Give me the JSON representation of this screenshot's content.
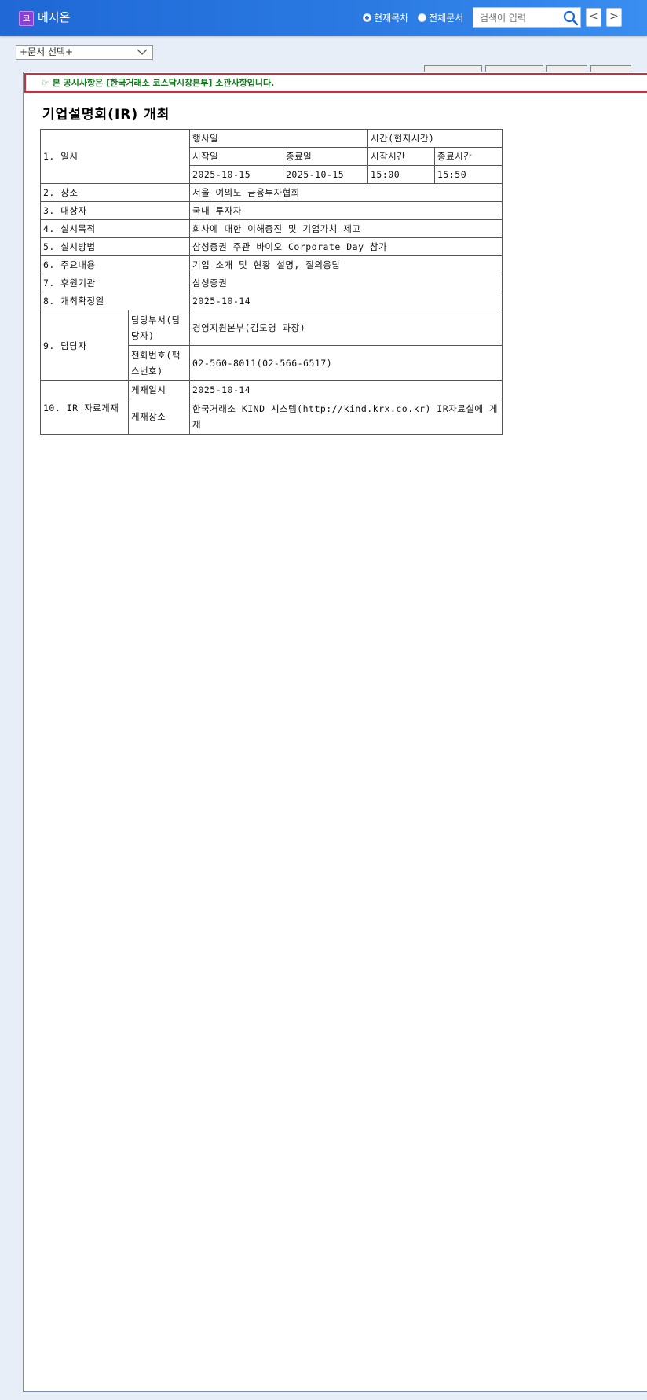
{
  "header": {
    "company_badge": "코",
    "company_name": "메지온",
    "radio_current": "현재목차",
    "radio_all": "전체문서",
    "search_placeholder": "검색어 입력",
    "prev": "<",
    "next": ">"
  },
  "toolbar": {
    "doc_select": "+문서 선택+"
  },
  "notice": {
    "text": "본 공시사항은 [한국거래소 코스닥시장본부] 소관사항입니다."
  },
  "document": {
    "title": "기업설명회(IR) 개최",
    "row1_label": "1. 일시",
    "event_day": "행사일",
    "time_local": "시간(현지시간)",
    "start_day": "시작일",
    "end_day": "종료일",
    "start_time": "시작시간",
    "end_time": "종료시간",
    "start_date_val": "2025-10-15",
    "end_date_val": "2025-10-15",
    "start_time_val": "15:00",
    "end_time_val": "15:50",
    "row2_label": "2. 장소",
    "row2_val": "서울 여의도 금융투자협회",
    "row3_label": "3. 대상자",
    "row3_val": "국내 투자자",
    "row4_label": "4. 실시목적",
    "row4_val": "회사에 대한 이해증진 및 기업가치 제고",
    "row5_label": "5. 실시방법",
    "row5_val": "삼성증권 주관 바이오 Corporate Day 참가",
    "row6_label": "6. 주요내용",
    "row6_val": "기업 소개 및 현황 설명, 질의응답",
    "row7_label": "7. 후원기관",
    "row7_val": "삼성증권",
    "row8_label": "8. 개최확정일",
    "row8_val": "2025-10-14",
    "row9_label": "9. 담당자",
    "row9_sub1_label": "담당부서(담당자)",
    "row9_sub1_val": "경영지원본부(김도영 과장)",
    "row9_sub2_label": "전화번호(팩스번호)",
    "row9_sub2_val": "02-560-8011(02-566-6517)",
    "row10_label": "10. IR 자료게재",
    "row10_sub1_label": "게재일시",
    "row10_sub1_val": "2025-10-14",
    "row10_sub2_label": "게재장소",
    "row10_sub2_val": "한국거래소 KIND 시스템(http://kind.krx.co.kr) IR자료실에 게재"
  },
  "colors": {
    "topbar": "#2b7be3",
    "notice_border": "#d42b3a",
    "notice_text": "#0f7a1a"
  }
}
